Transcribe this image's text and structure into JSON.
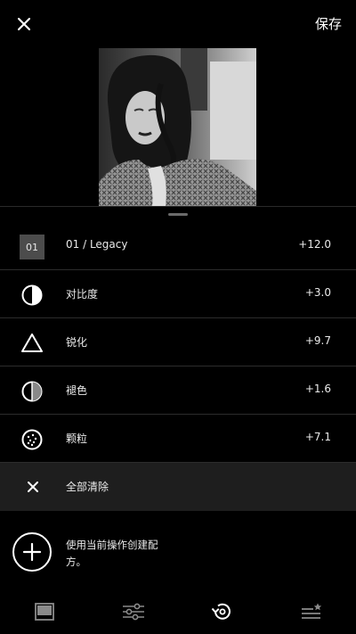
{
  "header": {
    "save_label": "保存"
  },
  "sheet": {
    "rows": [
      {
        "badge": "01",
        "label": "01 / Legacy",
        "value": "+12.0"
      },
      {
        "label": "对比度",
        "value": "+3.0"
      },
      {
        "label": "锐化",
        "value": "+9.7"
      },
      {
        "label": "褪色",
        "value": "+1.6"
      },
      {
        "label": "颗粒",
        "value": "+7.1"
      }
    ],
    "clear_label": "全部清除"
  },
  "recipe": {
    "text": "使用当前操作创建配方。"
  },
  "colors": {
    "background": "#000000",
    "clear_row": "#1e1e1e",
    "text": "#eaeaea",
    "divider": "#2c2c2c"
  },
  "icons": [
    "close-icon",
    "contrast-icon",
    "sharpen-icon",
    "fade-icon",
    "grain-icon",
    "clear-icon",
    "plus-icon",
    "presets-tab-icon",
    "tools-tab-icon",
    "history-tab-icon",
    "recipes-tab-icon"
  ]
}
